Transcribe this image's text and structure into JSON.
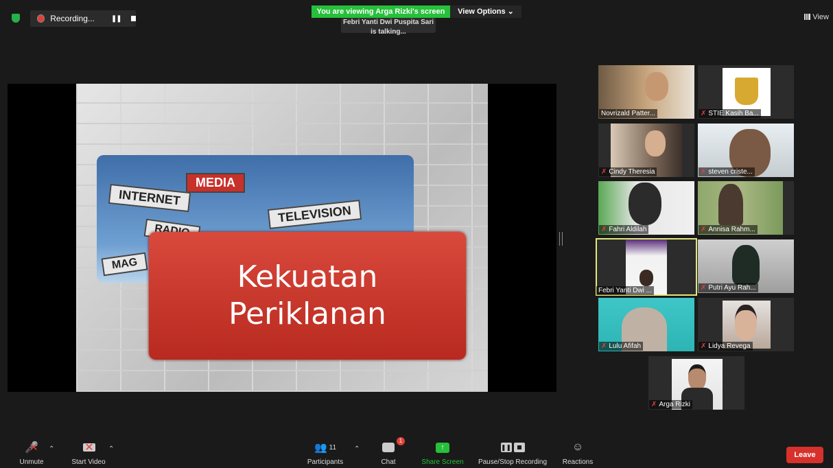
{
  "top": {
    "recording_label": "Recording...",
    "viewing_banner": "You are viewing Arga Rizki's screen",
    "view_options": "View Options ⌄",
    "talking": "Febri Yanti Dwi Puspita Sari is talking...",
    "view_label": "View"
  },
  "slide": {
    "signs": [
      "MEDIA",
      "INTERNET",
      "TELEVISION",
      "RADIO",
      "MAG"
    ],
    "title_line1": "Kekuatan",
    "title_line2": "Periklanan"
  },
  "participants": [
    {
      "name": "Novrizald Patter...",
      "muted": false
    },
    {
      "name": "STIE Kasih Ba...",
      "muted": true
    },
    {
      "name": "Cindy Theresia",
      "muted": true
    },
    {
      "name": "steven criste...",
      "muted": true
    },
    {
      "name": "Fahri Aldilah",
      "muted": true
    },
    {
      "name": "Annisa Rahm...",
      "muted": true
    },
    {
      "name": "Febri Yanti Dwi ...",
      "muted": false
    },
    {
      "name": "Putri Ayu Rah...",
      "muted": true
    },
    {
      "name": "Lulu Afifah",
      "muted": true
    },
    {
      "name": "Lidya Revega",
      "muted": true
    },
    {
      "name": "Arga Rizki",
      "muted": true
    }
  ],
  "toolbar": {
    "unmute": "Unmute",
    "start_video": "Start Video",
    "participants": "Participants",
    "participants_count": "11",
    "chat": "Chat",
    "chat_badge": "1",
    "share_screen": "Share Screen",
    "pause_stop": "Pause/Stop Recording",
    "reactions": "Reactions",
    "leave": "Leave"
  },
  "colors": {
    "accent_green": "#26c03a",
    "leave_red": "#d7312c",
    "active_speaker": "#e4e87c"
  }
}
